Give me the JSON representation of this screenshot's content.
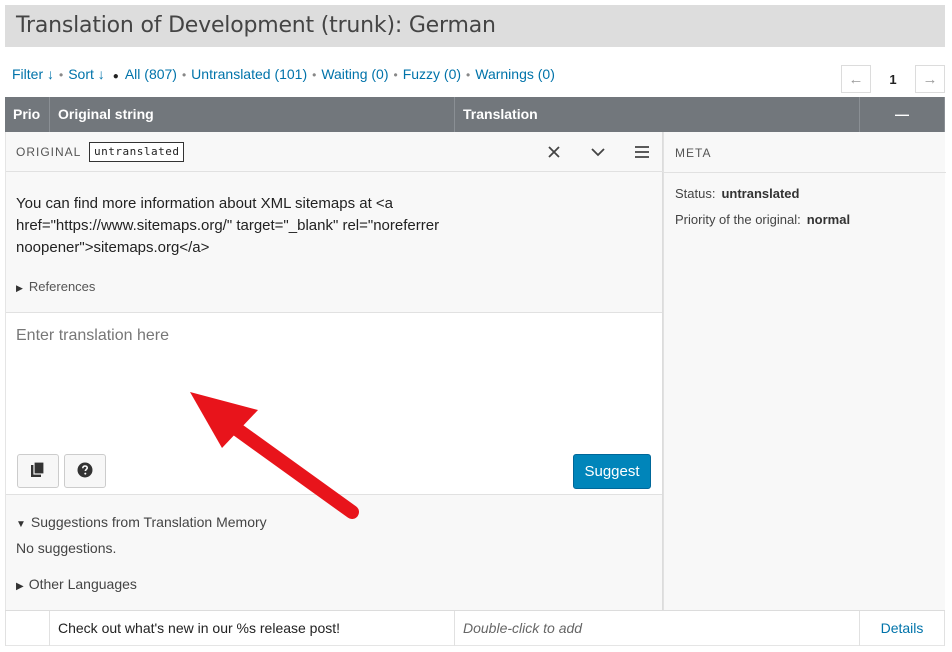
{
  "page": {
    "title": "Translation of Development (trunk): German"
  },
  "filters": {
    "filter": "Filter ↓",
    "sort": "Sort ↓",
    "all": "All (807)",
    "untranslated": "Untranslated (101)",
    "waiting": "Waiting (0)",
    "fuzzy": "Fuzzy (0)",
    "warnings": "Warnings (0)"
  },
  "pager": {
    "prev": "←",
    "current": "1",
    "next": "→"
  },
  "table": {
    "headers": {
      "prio": "Prio",
      "original": "Original string",
      "translation": "Translation",
      "collapse": "—"
    }
  },
  "editor": {
    "original_label": "ORIGINAL",
    "status_badge": "untranslated",
    "original_text": "You can find more information about XML sitemaps at <a href=\"https://www.sitemaps.org/\" target=\"_blank\" rel=\"noreferrer noopener\">sitemaps.org</a>",
    "references": "References",
    "translation_placeholder": "Enter translation here",
    "suggest_label": "Suggest",
    "tm_title": "Suggestions from Translation Memory",
    "no_suggestions": "No suggestions.",
    "other_languages": "Other Languages",
    "icons": {
      "close": "close-icon",
      "next": "chevron-down-icon",
      "menu": "menu-icon",
      "copy": "copy-icon",
      "help": "help-icon"
    }
  },
  "meta": {
    "title": "META",
    "status_label": "Status:",
    "status_value": "untranslated",
    "priority_label": "Priority of the original:",
    "priority_value": "normal"
  },
  "rows": [
    {
      "original": "Check out what's new in our %s release post!",
      "translation": "Double-click to add",
      "details": "Details"
    }
  ],
  "colors": {
    "accent": "#0073aa",
    "button": "#0085ba",
    "header": "#72777c",
    "arrow": "#e8141b"
  }
}
